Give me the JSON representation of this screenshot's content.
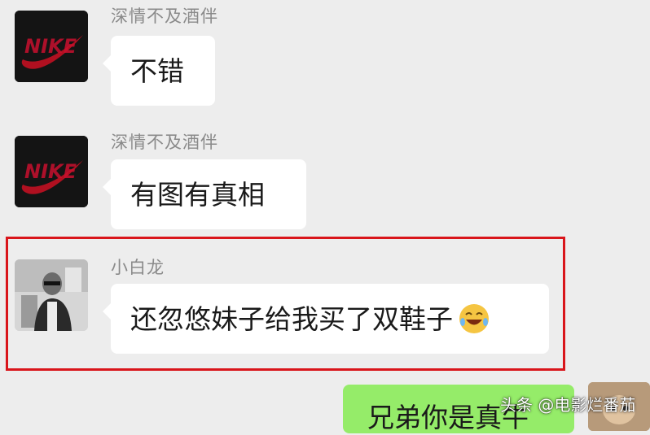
{
  "messages": [
    {
      "sender": "深情不及酒伴",
      "text": "不错",
      "avatar_icon": "nike-logo"
    },
    {
      "sender": "深情不及酒伴",
      "text": "有图有真相",
      "avatar_icon": "nike-logo"
    },
    {
      "sender": "小白龙",
      "text": "还忽悠妹子给我买了双鞋子",
      "avatar_icon": "person-photo",
      "emoji": "laughing-face"
    }
  ],
  "self_message": {
    "text": "兄弟你是真牛"
  },
  "watermark": "头条 @电影烂番茄",
  "colors": {
    "background": "#ededed",
    "bubble_incoming": "#ffffff",
    "bubble_outgoing": "#95ec69",
    "highlight_border": "#d9151b",
    "nike_red": "#c8102e"
  }
}
